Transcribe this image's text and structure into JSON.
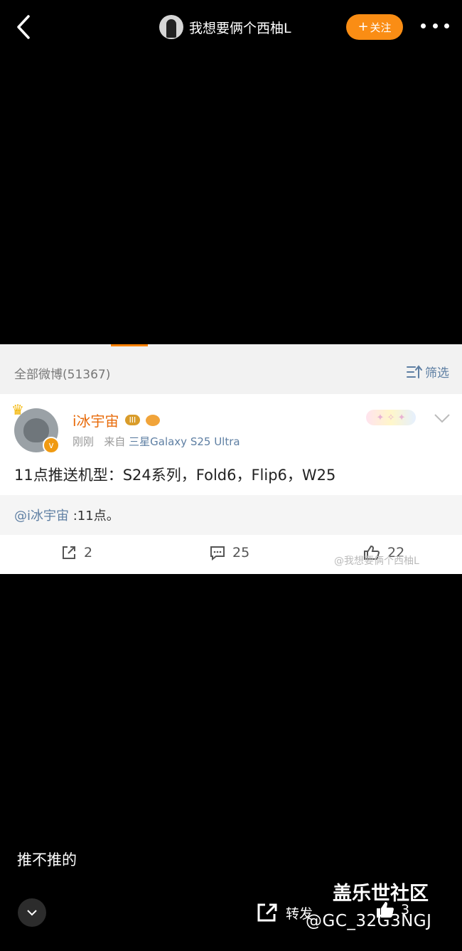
{
  "header": {
    "author_name": "我想要俩个西柚L",
    "follow_label": "关注"
  },
  "screenshot": {
    "all_posts_label": "全部微博(51367)",
    "filter_label": "筛选",
    "post": {
      "username": "i冰宇宙",
      "badge": "III",
      "time": "刚刚",
      "source_prefix": "来自",
      "source_device": "三星Galaxy S25 Ultra",
      "text": "11点推送机型：S24系列，Fold6，Flip6，W25",
      "quote_at": "@i冰宇宙",
      "quote_text": " :11点。",
      "repost_count": "2",
      "comment_count": "25",
      "like_count": "22",
      "watermark": "@我想要俩个西柚L"
    }
  },
  "comment_text": "推不推的",
  "bottom": {
    "forward_label": "转发",
    "like_count": "3",
    "brand": "盖乐世社区",
    "handle": "@GC_32G3NGJ"
  },
  "colors": {
    "accent": "#fa8d14",
    "username": "#e86b0b",
    "link": "#5e7fa3"
  }
}
